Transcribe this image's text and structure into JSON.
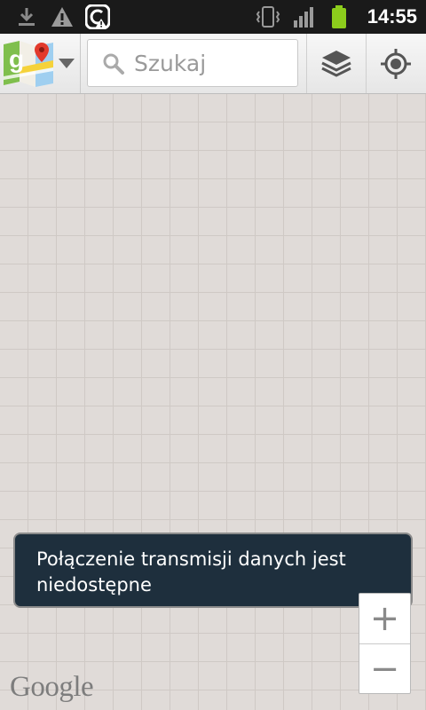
{
  "status_bar": {
    "time": "14:55",
    "icons": [
      "download-icon",
      "warning-icon",
      "sync-alert-icon",
      "vibrate-icon",
      "signal-icon",
      "battery-icon"
    ],
    "battery_color": "#8ccc1c"
  },
  "toolbar": {
    "search_placeholder": "Szukaj",
    "icons": [
      "maps-logo-icon",
      "dropdown-arrow-icon",
      "search-icon",
      "layers-icon",
      "my-location-icon"
    ]
  },
  "toast": {
    "message": "Połączenie transmisji danych jest niedostępne"
  },
  "zoom": {
    "in_label": "+",
    "out_label": "−"
  },
  "map": {
    "watermark": "Google",
    "grid_color": "#cfc9c5",
    "background_color": "#e0dbd8"
  }
}
